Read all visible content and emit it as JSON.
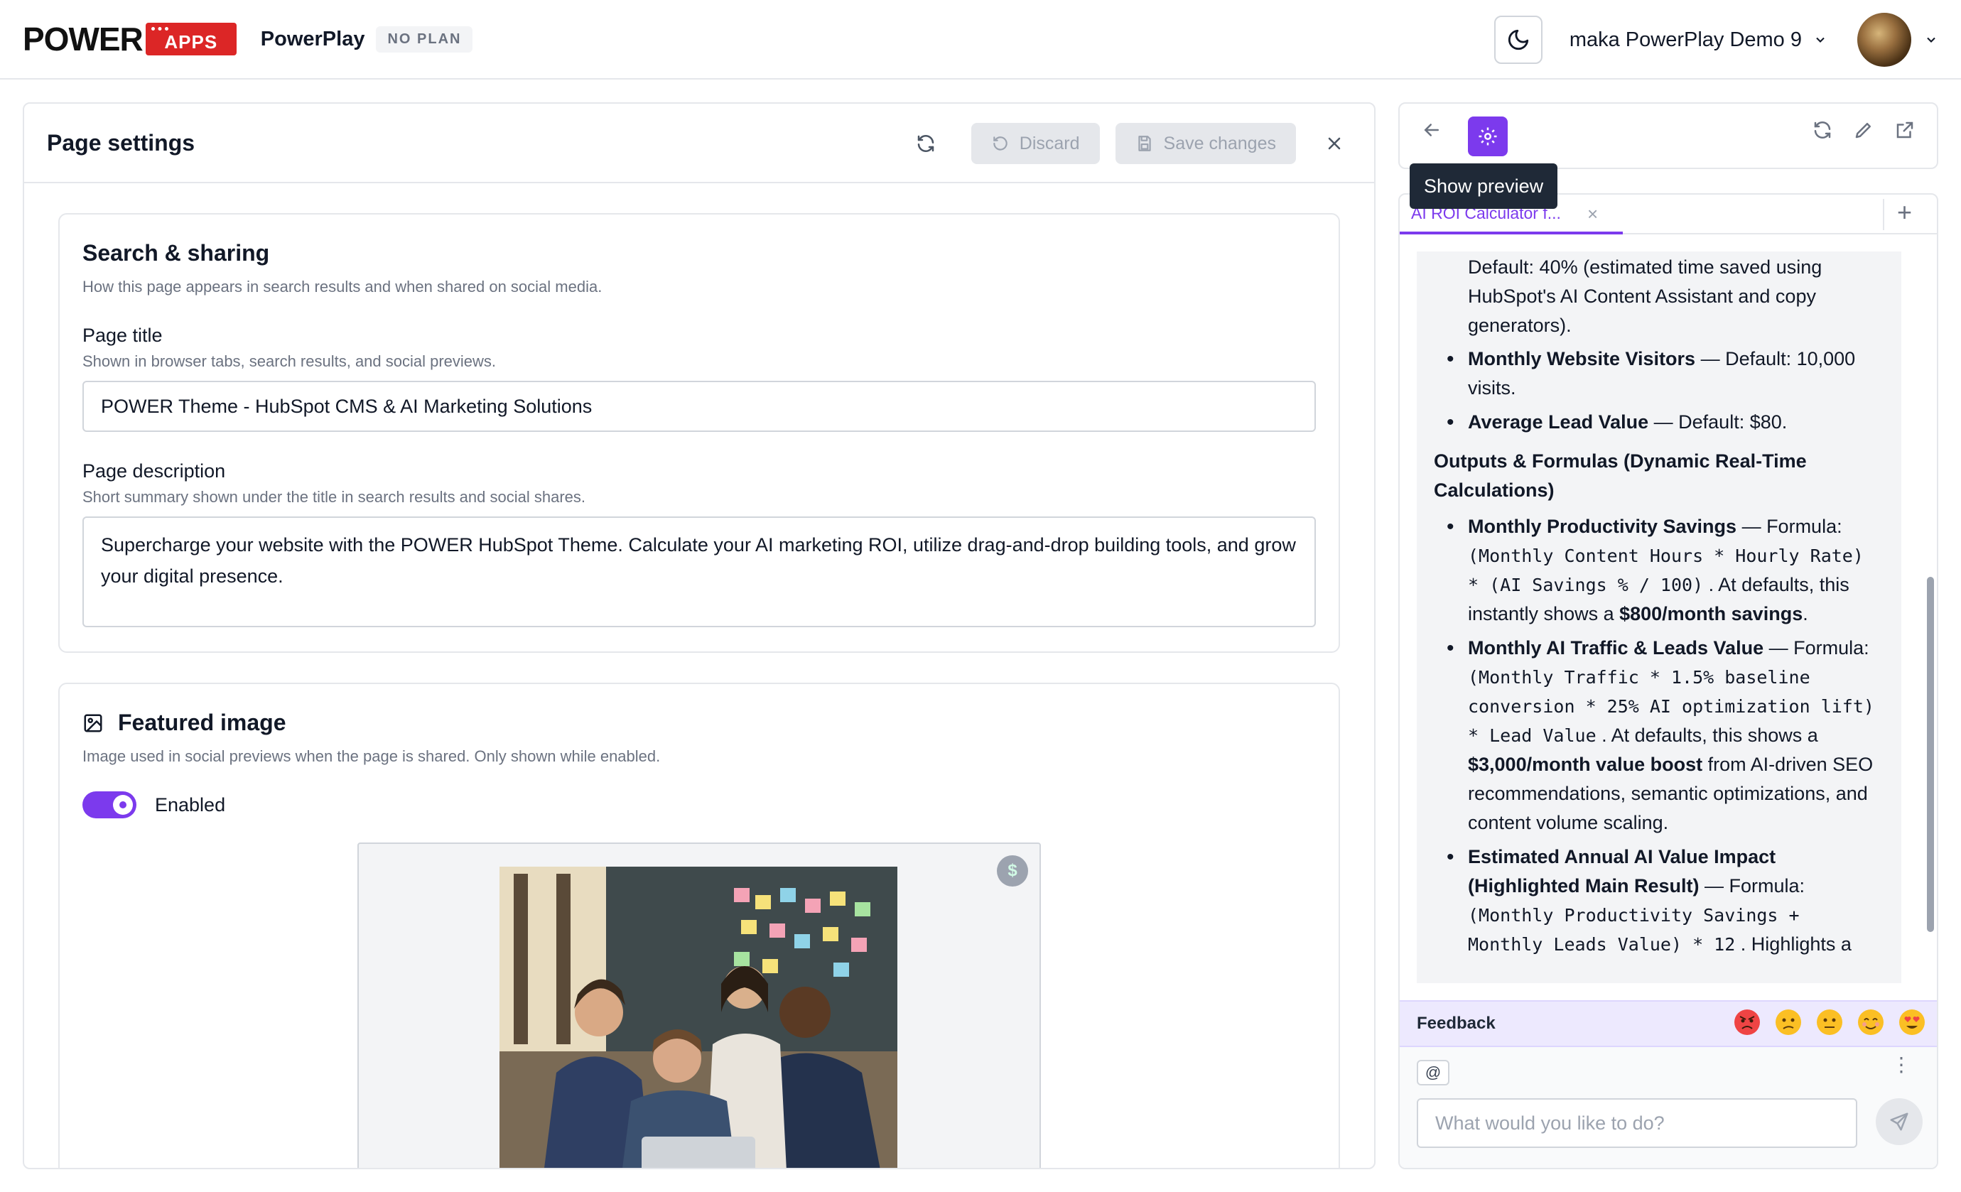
{
  "header": {
    "logo_power": "POWER",
    "logo_apps": "APPS",
    "app_name": "PowerPlay",
    "plan_badge": "NO PLAN",
    "workspace_name": "maka PowerPlay Demo 9"
  },
  "page_settings": {
    "title": "Page settings",
    "discard_label": "Discard",
    "save_label": "Save changes"
  },
  "search_sharing": {
    "title": "Search & sharing",
    "subtitle": "How this page appears in search results and when shared on social media.",
    "page_title_label": "Page title",
    "page_title_hint": "Shown in browser tabs, search results, and social previews.",
    "page_title_value": "POWER Theme - HubSpot CMS & AI Marketing Solutions",
    "page_desc_label": "Page description",
    "page_desc_hint": "Short summary shown under the title in search results and social shares.",
    "page_desc_value": "Supercharge your website with the POWER HubSpot Theme. Calculate your AI marketing ROI, utilize drag-and-drop building tools, and grow your digital presence."
  },
  "featured_image": {
    "title": "Featured image",
    "subtitle": "Image used in social previews when the page is shared. Only shown while enabled.",
    "toggle_label": "Enabled",
    "toggle_on": true,
    "badge_symbol": "$"
  },
  "preview_toolbar": {
    "tooltip": "Show preview"
  },
  "chat": {
    "tab_label": "AI ROI Calculator f...",
    "msg": {
      "l1": "Default: 40% (estimated time saved using HubSpot's AI Content Assistant and copy generators).",
      "b1_bold": "Monthly Website Visitors",
      "b1_text": " — Default: 10,000 visits.",
      "b2_bold": "Average Lead Value",
      "b2_text": " — Default: $80.",
      "heading": "Outputs & Formulas (Dynamic Real-Time Calculations)",
      "o1_bold": "Monthly Productivity Savings",
      "o1_pre": " — Formula: ",
      "o1_code": "(Monthly Content Hours * Hourly Rate) * (AI Savings % / 100)",
      "o1_mid": " . At defaults, this instantly shows a ",
      "o1_bold2": "$800/month savings",
      "o1_end": ".",
      "o2_bold": "Monthly AI Traffic & Leads Value",
      "o2_pre": " — Formula: ",
      "o2_code": "(Monthly Traffic * 1.5% baseline conversion * 25% AI optimization lift) * Lead Value",
      "o2_mid": " . At defaults, this shows a ",
      "o2_bold2": "$3,000/month value boost",
      "o2_end": " from AI-driven SEO recommendations, semantic optimizations, and content volume scaling.",
      "o3_bold": "Estimated Annual AI Value Impact (Highlighted Main Result)",
      "o3_pre": " — Formula: ",
      "o3_code": "(Monthly Productivity Savings + Monthly Leads Value) * 12",
      "o3_end": " . Highlights a"
    },
    "feedback_label": "Feedback",
    "at_label": "@",
    "input_placeholder": "What would you like to do?"
  },
  "colors": {
    "accent": "#7c3aed",
    "logo_red": "#dc2626"
  }
}
